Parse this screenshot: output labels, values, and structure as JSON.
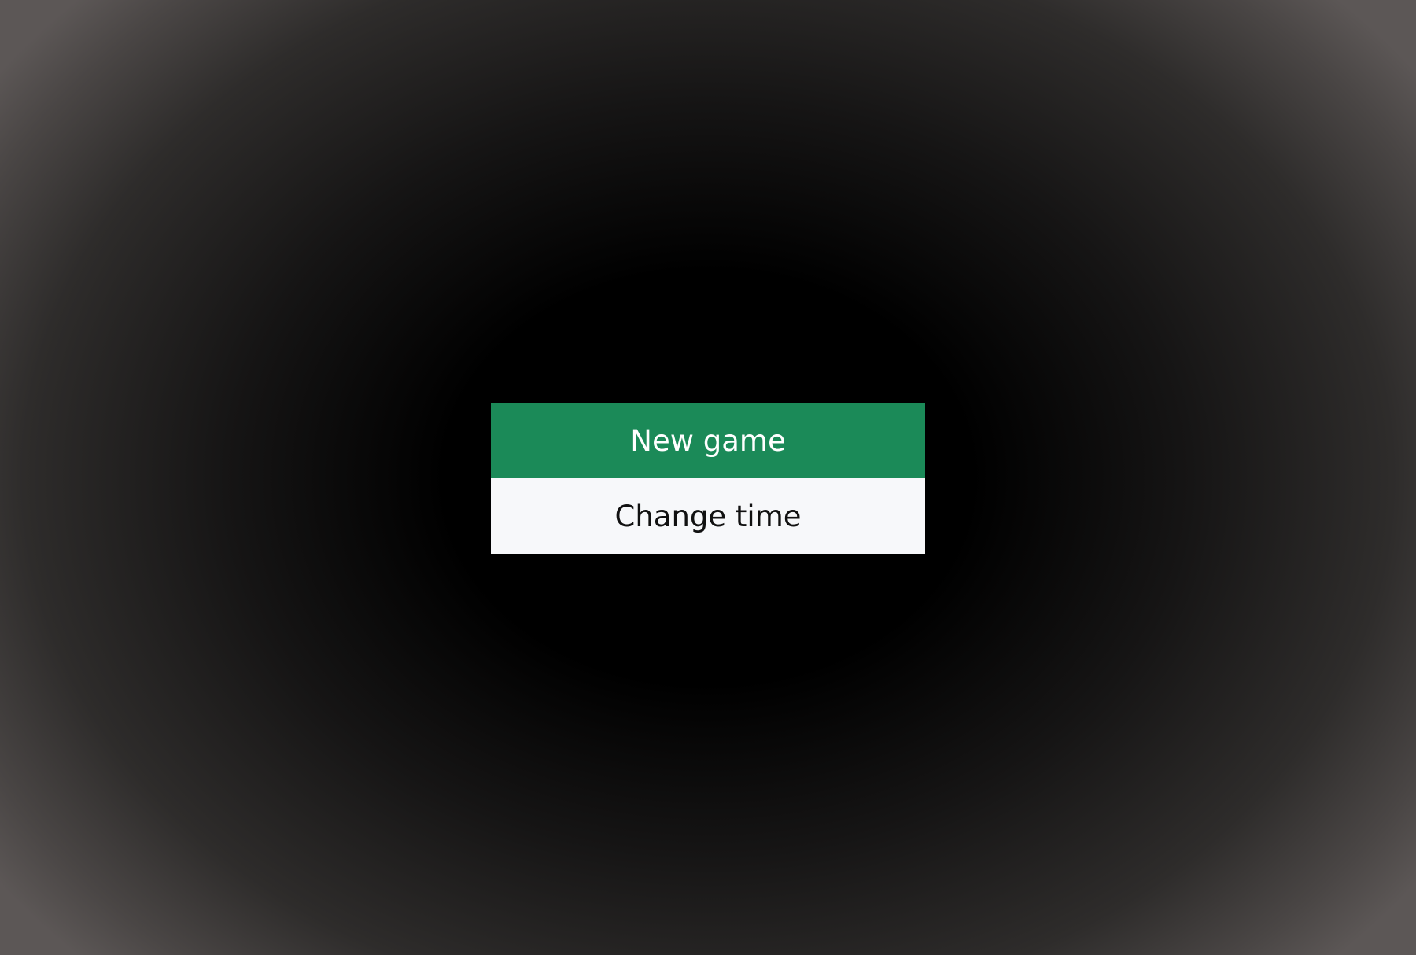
{
  "menu": {
    "new_game_label": "New game",
    "change_time_label": "Change time"
  },
  "colors": {
    "primary_button_bg": "#1b8a58",
    "primary_button_text": "#ffffff",
    "secondary_button_bg": "#f7f8fa",
    "secondary_button_text": "#111111",
    "background_center": "#000000",
    "background_edge": "#5c5756"
  }
}
